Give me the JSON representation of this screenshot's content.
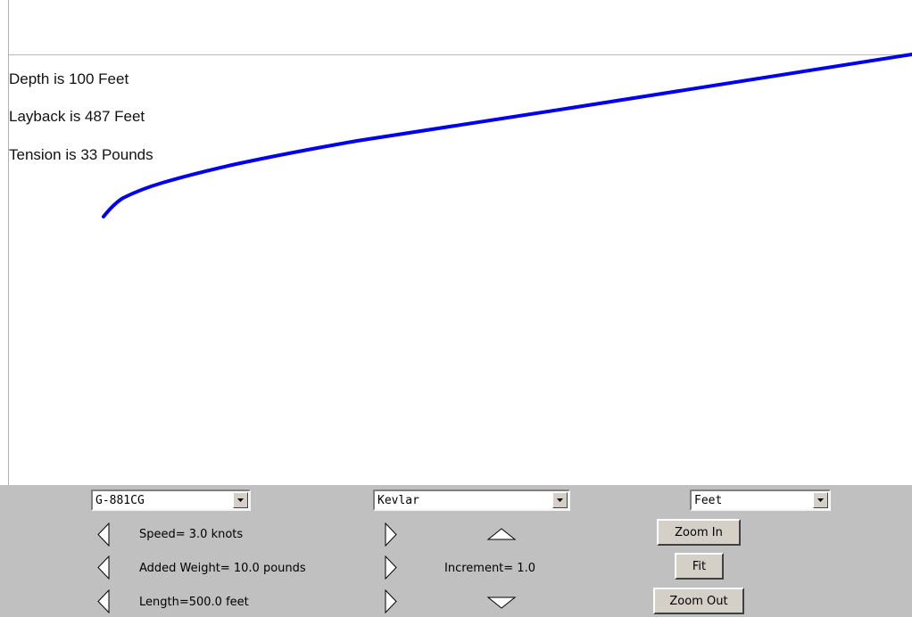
{
  "readouts": {
    "depth": "Depth is 100 Feet",
    "layback": "Layback is 487 Feet",
    "tension": "Tension is 33 Pounds"
  },
  "controls": {
    "cable_select": "G-881CG",
    "material_select": "Kevlar",
    "units_select": "Feet",
    "speed_label": "Speed= 3.0 knots",
    "weight_label": "Added Weight= 10.0 pounds",
    "length_label": "Length=500.0 feet",
    "increment_label": "Increment= 1.0",
    "zoom_in": "Zoom In",
    "fit": "Fit",
    "zoom_out": "Zoom Out"
  },
  "icons": {
    "decrease": "left-triangle-icon",
    "increase": "right-triangle-icon",
    "increment_up": "up-triangle-icon",
    "increment_down": "down-triangle-icon",
    "dropdown": "chevron-down-icon"
  },
  "colors": {
    "cable_curve": "#0000ee",
    "panel_background": "#c0c0c0"
  }
}
